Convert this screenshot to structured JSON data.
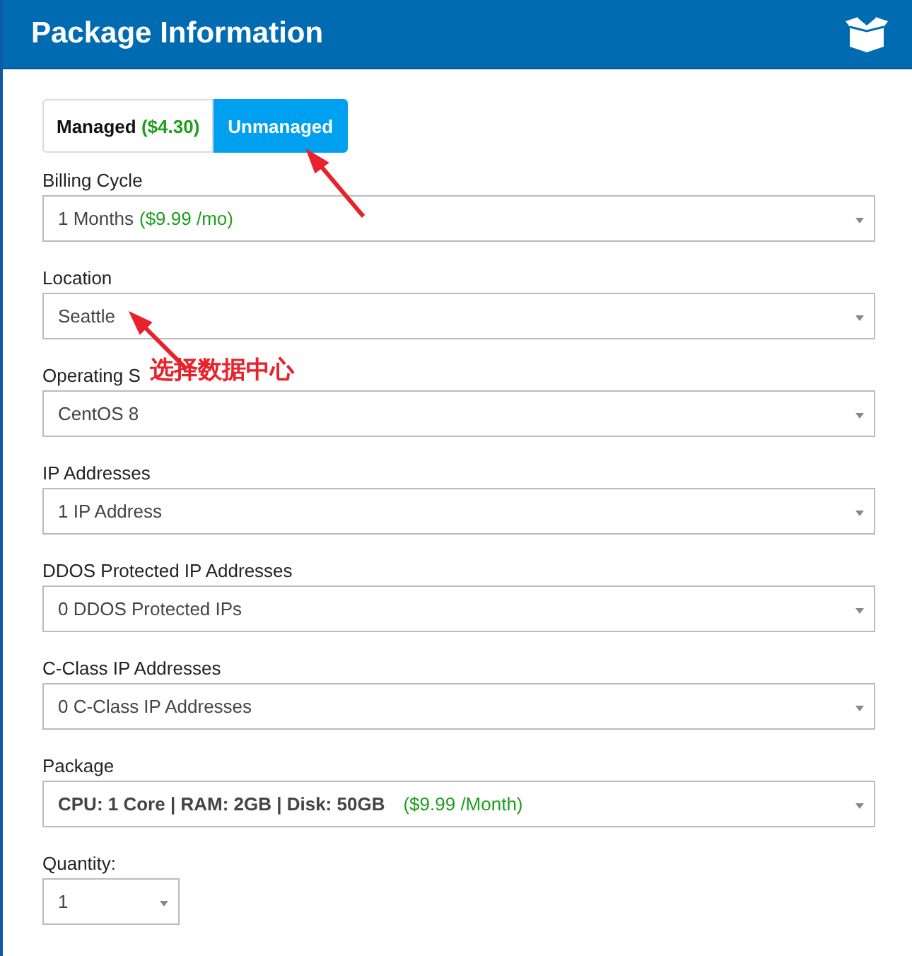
{
  "header": {
    "title": "Package Information"
  },
  "management": [
    {
      "label": "Managed",
      "price": "($4.30)",
      "selected": false
    },
    {
      "label": "Unmanaged",
      "selected": true
    }
  ],
  "fields": [
    {
      "kind": "select",
      "label": "Billing Cycle",
      "value": "1 Months",
      "price": "($9.99 /mo)"
    },
    {
      "kind": "select",
      "label": "Location",
      "value": "Seattle"
    },
    {
      "kind": "select",
      "label": "Operating S",
      "value": "CentOS 8"
    },
    {
      "kind": "select",
      "label": "IP Addresses",
      "value": "1 IP Address"
    },
    {
      "kind": "select",
      "label": "DDOS Protected IP Addresses",
      "value": "0 DDOS Protected IPs"
    },
    {
      "kind": "select",
      "label": "C-Class IP Addresses",
      "value": "0 C-Class IP Addresses"
    },
    {
      "kind": "package",
      "label": "Package",
      "value": "CPU: 1 Core | RAM: 2GB | Disk: 50GB",
      "price": "($9.99 /Month)"
    },
    {
      "kind": "small",
      "label": "Quantity:",
      "value": "1"
    }
  ],
  "annotation": {
    "text": "选择数据中心"
  }
}
